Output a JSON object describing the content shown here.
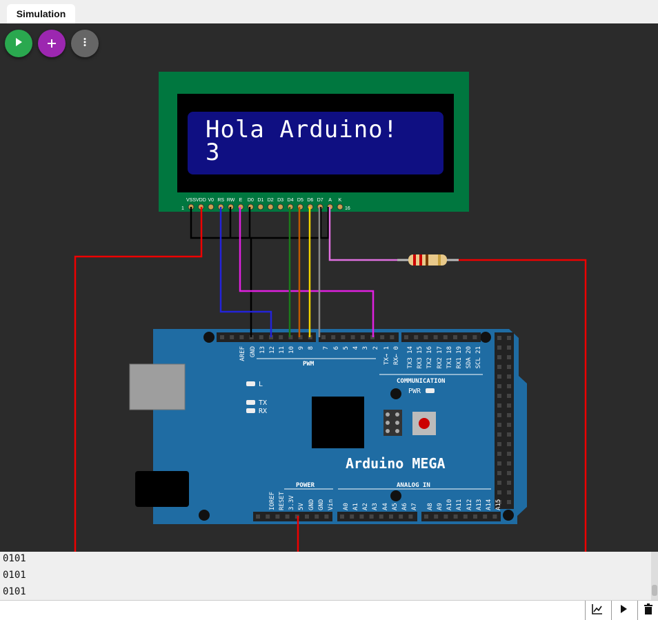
{
  "tabs": {
    "simulation": "Simulation"
  },
  "toolbar": {
    "run_icon": "play-icon",
    "add_icon": "plus-icon",
    "more_icon": "more-vertical-icon",
    "colors": {
      "run": "#2aa84f",
      "add": "#9c27b0",
      "more": "#666666"
    }
  },
  "lcd": {
    "line1": "Hola Arduino!",
    "line2": "3",
    "pins": [
      "VSS",
      "VDD",
      "V0",
      "RS",
      "RW",
      "E",
      "D0",
      "D1",
      "D2",
      "D3",
      "D4",
      "D5",
      "D6",
      "D7",
      "A",
      "K"
    ],
    "pin_first": "1",
    "pin_last": "16",
    "colors": {
      "pcb": "#00773f",
      "screen": "#0f0f82"
    }
  },
  "board": {
    "name": "Arduino MEGA",
    "top_pins": [
      "AREF",
      "GND",
      "13",
      "12",
      "11",
      "10",
      "9",
      "8",
      "7",
      "6",
      "5",
      "4",
      "3",
      "2",
      "TX→ 1",
      "RX← 0",
      "TX3 14",
      "RX3 15",
      "TX2 16",
      "RX2 17",
      "TX1 18",
      "RX1 19",
      "SDA 20",
      "SCL 21"
    ],
    "pwm_label": "PWM",
    "comm_label": "COMMUNICATION",
    "power_label": "POWER",
    "analog_label": "ANALOG IN",
    "power_pins": [
      "IOREF",
      "RESET",
      "3.3V",
      "5V",
      "GND",
      "GND",
      "Vin"
    ],
    "analog_pins": [
      "A0",
      "A1",
      "A2",
      "A3",
      "A4",
      "A5",
      "A6",
      "A7",
      "A8",
      "A9",
      "A10",
      "A11",
      "A12",
      "A13",
      "A14",
      "A15"
    ],
    "led_l": "L",
    "led_tx": "TX",
    "led_rx": "RX",
    "pwr_label": "PWR",
    "color": "#1f6ca3"
  },
  "serial_monitor": {
    "lines": [
      "0101",
      "0101",
      "0101"
    ]
  },
  "serial_toolbar": {
    "plot_icon": "chart-line-icon",
    "play_icon": "play-icon",
    "clear_icon": "trash-icon"
  }
}
